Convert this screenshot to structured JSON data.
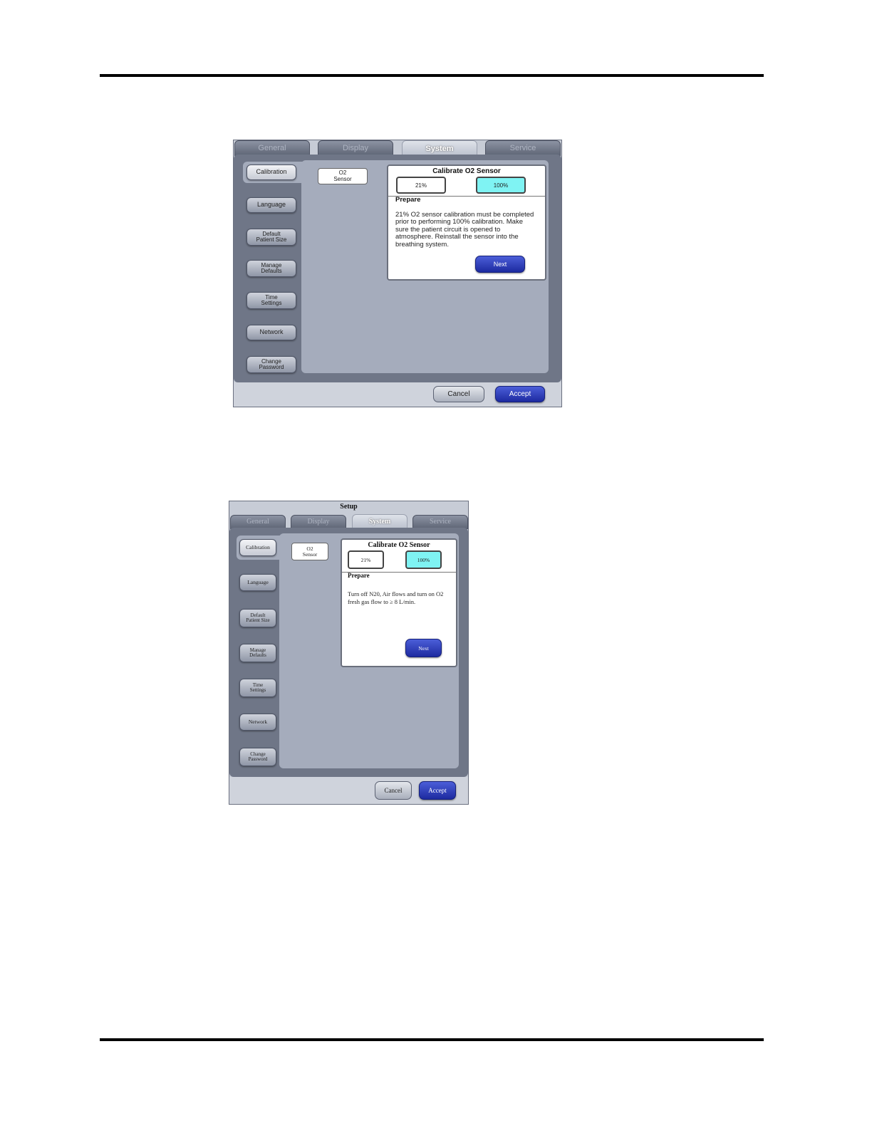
{
  "screen1": {
    "tabs": [
      "General",
      "Display",
      "System",
      "Service"
    ],
    "active_tab": "System",
    "sidebar": [
      "Calibration",
      "Language",
      "Default\nPatient Size",
      "Manage\nDefaults",
      "Time\nSettings",
      "Network",
      "Change\nPassword"
    ],
    "o2_button": "O2\nSensor",
    "panel": {
      "title": "Calibrate O2 Sensor",
      "btn_21": "21%",
      "btn_100": "100%",
      "prepare": "Prepare",
      "text": "21% O2 sensor calibration must be completed prior to performing 100% calibration. Make sure the patient circuit is opened to atmosphere. Reinstall the sensor into the breathing system.",
      "next": "Next"
    },
    "cancel": "Cancel",
    "accept": "Accept"
  },
  "screen2": {
    "title": "Setup",
    "tabs": [
      "General",
      "Display",
      "System",
      "Service"
    ],
    "active_tab": "System",
    "sidebar": [
      "Calibration",
      "Language",
      "Default\nPatient Size",
      "Manage\nDefaults",
      "Time\nSettings",
      "Network",
      "Change\nPassword"
    ],
    "o2_button": "O2\nSensor",
    "panel": {
      "title": "Calibrate O2 Sensor",
      "btn_21": "21%",
      "btn_100": "100%",
      "prepare": "Prepare",
      "text": "Turn off N20, Air flows and turn on O2 fresh gas flow to ≥ 8 L/min.",
      "next": "Next"
    },
    "cancel": "Cancel",
    "accept": "Accept"
  }
}
